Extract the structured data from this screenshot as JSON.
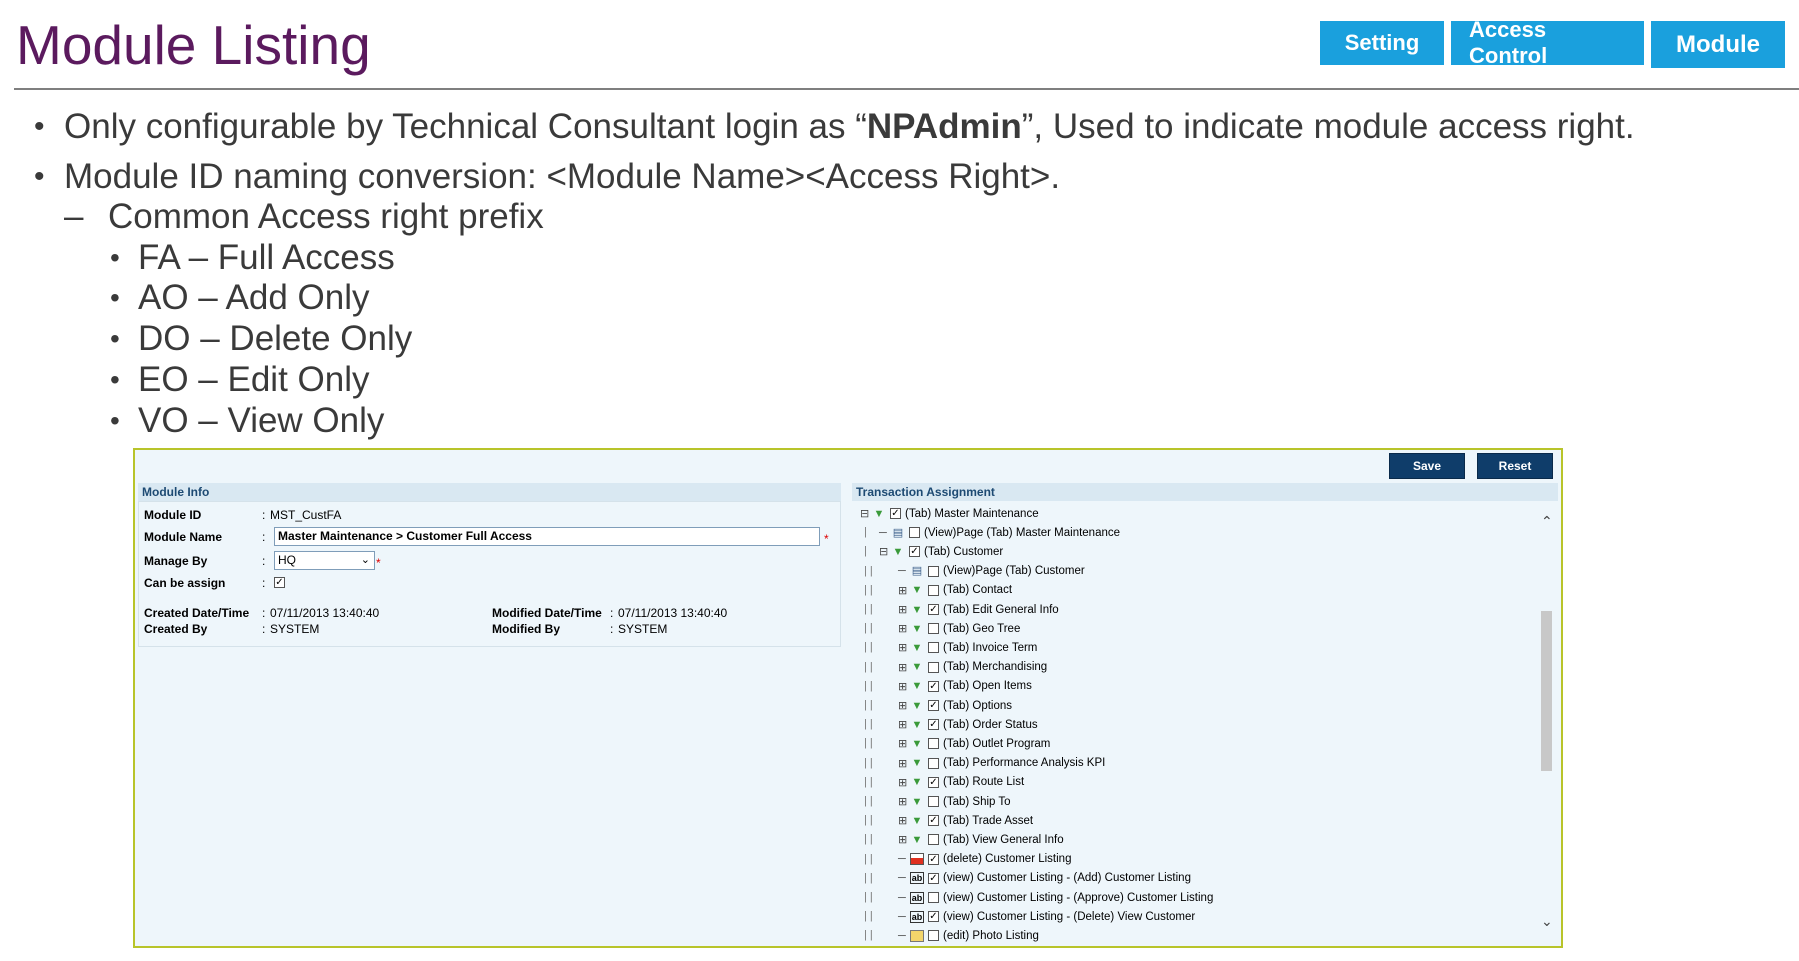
{
  "slide": {
    "title": "Module Listing",
    "nav_tabs": [
      "Setting",
      "Access Control",
      "Module"
    ]
  },
  "bullets": {
    "line1_pre": "Only configurable by Technical Consultant login as “",
    "line1_bold": "NPAdmin",
    "line1_post": "”, Used to indicate module access right.",
    "line2": "Module ID naming conversion: <Module Name><Access Right>.",
    "sub": "Common Access right prefix",
    "prefixes": [
      "FA – Full Access",
      "AO – Add Only",
      "DO – Delete Only",
      "EO – Edit Only",
      "VO – View Only"
    ]
  },
  "screen": {
    "buttons": {
      "save": "Save",
      "reset": "Reset"
    },
    "module_info": {
      "heading": "Module Info",
      "module_id_label": "Module ID",
      "module_id": "MST_CustFA",
      "module_name_label": "Module Name",
      "module_name": "Master Maintenance > Customer Full Access",
      "manage_by_label": "Manage By",
      "manage_by": "HQ",
      "can_be_assign_label": "Can be assign",
      "can_be_assign": true,
      "created_date_label": "Created Date/Time",
      "created_date": "07/11/2013 13:40:40",
      "created_by_label": "Created By",
      "created_by": "SYSTEM",
      "modified_date_label": "Modified Date/Time",
      "modified_date": "07/11/2013 13:40:40",
      "modified_by_label": "Modified By",
      "modified_by": "SYSTEM",
      "colon": ":",
      "required_mark": "*"
    },
    "transaction": {
      "heading": "Transaction Assignment",
      "nodes": [
        {
          "label": "(Tab) Master Maintenance",
          "checked": true,
          "icon": "tab-icon"
        },
        {
          "label": "(View)Page (Tab) Master Maintenance",
          "checked": false,
          "icon": "view-icon"
        },
        {
          "label": "(Tab) Customer",
          "checked": true,
          "icon": "tab-icon"
        },
        {
          "label": "(View)Page (Tab) Customer",
          "checked": false,
          "icon": "view-icon"
        },
        {
          "label": "(Tab) Contact",
          "checked": false,
          "icon": "tab-icon"
        },
        {
          "label": "(Tab) Edit General Info",
          "checked": true,
          "icon": "tab-icon"
        },
        {
          "label": "(Tab) Geo Tree",
          "checked": false,
          "icon": "tab-icon"
        },
        {
          "label": "(Tab) Invoice Term",
          "checked": false,
          "icon": "tab-icon"
        },
        {
          "label": "(Tab) Merchandising",
          "checked": false,
          "icon": "tab-icon"
        },
        {
          "label": "(Tab) Open Items",
          "checked": true,
          "icon": "tab-icon"
        },
        {
          "label": "(Tab) Options",
          "checked": true,
          "icon": "tab-icon"
        },
        {
          "label": "(Tab) Order Status",
          "checked": true,
          "icon": "tab-icon"
        },
        {
          "label": "(Tab) Outlet Program",
          "checked": false,
          "icon": "tab-icon"
        },
        {
          "label": "(Tab) Performance Analysis KPI",
          "checked": false,
          "icon": "tab-icon"
        },
        {
          "label": "(Tab) Route List",
          "checked": true,
          "icon": "tab-icon"
        },
        {
          "label": "(Tab) Ship To",
          "checked": false,
          "icon": "tab-icon"
        },
        {
          "label": "(Tab) Trade Asset",
          "checked": true,
          "icon": "tab-icon"
        },
        {
          "label": "(Tab) View General Info",
          "checked": false,
          "icon": "tab-icon"
        },
        {
          "label": "(delete) Customer Listing",
          "checked": true,
          "icon": "delete-icon"
        },
        {
          "label": "(view) Customer Listing - (Add) Customer Listing",
          "checked": true,
          "icon": "ab-icon"
        },
        {
          "label": "(view) Customer Listing - (Approve) Customer Listing",
          "checked": false,
          "icon": "ab-icon"
        },
        {
          "label": "(view) Customer Listing - (Delete) View Customer",
          "checked": true,
          "icon": "ab-icon"
        },
        {
          "label": "(edit) Photo Listing",
          "checked": false,
          "icon": "edit-icon"
        }
      ]
    }
  },
  "colors": {
    "title": "#5b1a5e",
    "nav_tab": "#1aa0dd",
    "button": "#0f3d6a",
    "panel_bg": "#eef6fb",
    "frame": "#b8c42a"
  }
}
